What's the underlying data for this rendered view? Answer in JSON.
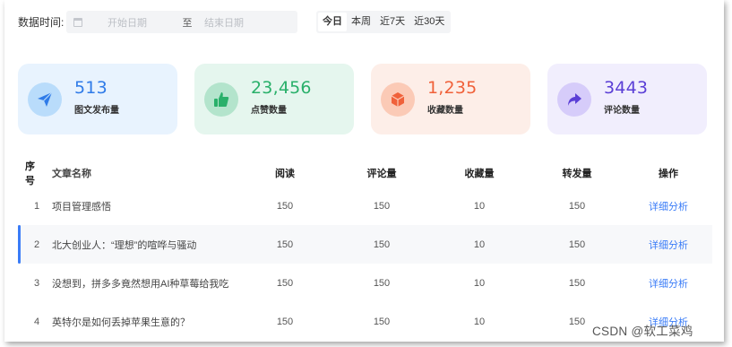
{
  "filter": {
    "label": "数据时间:",
    "start_placeholder": "开始日期",
    "separator": "至",
    "end_placeholder": "结束日期",
    "quick": [
      "今日",
      "本周",
      "近7天",
      "近30天"
    ],
    "quick_active": "今日"
  },
  "cards": [
    {
      "value": "513",
      "label": "图文发布量",
      "icon": "send-icon",
      "color": "#2f7be8",
      "bg": "#e8f3fe",
      "circle": "#b9dcfb"
    },
    {
      "value": "23,456",
      "label": "点赞数量",
      "icon": "thumbs-up-icon",
      "color": "#29b06a",
      "bg": "#e5f6ee",
      "circle": "#b3e4cc"
    },
    {
      "value": "1,235",
      "label": "收藏数量",
      "icon": "box-icon",
      "color": "#f0613a",
      "bg": "#fdeee8",
      "circle": "#fbcab6"
    },
    {
      "value": "3443",
      "label": "评论数量",
      "icon": "share-arrow-icon",
      "color": "#5b3fd6",
      "bg": "#f1eefd",
      "circle": "#d6ccfa"
    }
  ],
  "table": {
    "headers": [
      "序号",
      "文章名称",
      "阅读",
      "评论量",
      "收藏量",
      "转发量",
      "操作"
    ],
    "rows": [
      {
        "idx": "1",
        "title": "项目管理感悟",
        "read": "150",
        "comments": "150",
        "favorites": "10",
        "shares": "150",
        "action": "详细分析"
      },
      {
        "idx": "2",
        "title": "北大创业人：“理想”的喧哗与骚动",
        "read": "150",
        "comments": "150",
        "favorites": "10",
        "shares": "150",
        "action": "详细分析"
      },
      {
        "idx": "3",
        "title": "没想到，拼多多竟然想用AI种草莓给我吃",
        "read": "150",
        "comments": "150",
        "favorites": "10",
        "shares": "150",
        "action": "详细分析"
      },
      {
        "idx": "4",
        "title": "英特尔是如何丢掉苹果生意的？",
        "read": "150",
        "comments": "150",
        "favorites": "10",
        "shares": "150",
        "action": "详细分析"
      }
    ],
    "highlighted_row": 1
  },
  "watermark": "CSDN @软工菜鸡"
}
